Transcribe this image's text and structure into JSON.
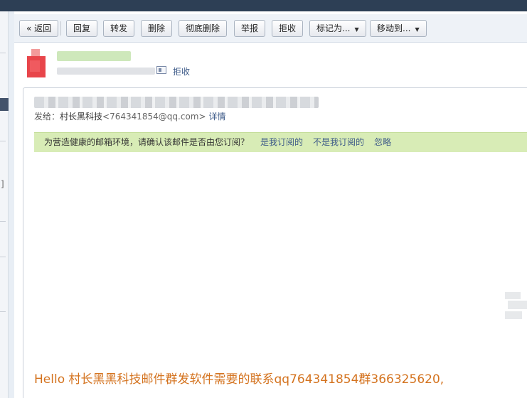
{
  "toolbar": {
    "back": "« 返回",
    "reply": "回复",
    "forward": "转发",
    "delete": "删除",
    "delete_permanent": "彻底删除",
    "report": "举报",
    "reject": "拒收",
    "mark_as": "标记为...",
    "move_to": "移动到..."
  },
  "header": {
    "reject_link": "拒收"
  },
  "mail": {
    "sendto_label": "发给：",
    "recipient_name": "村长黑科技",
    "recipient_email": "<764341854@qq.com>",
    "detail_link": "详情"
  },
  "notice": {
    "text": "为营造健康的邮箱环境，请确认该邮件是否由您订阅？",
    "yes_link": "是我订阅的",
    "no_link": "不是我订阅的",
    "ignore_link": "忽略"
  },
  "body": {
    "text": "Hello 村长黑黑科技邮件群发软件需要的联系qq764341854群366325620,"
  },
  "colors": {
    "topbar": "#2d3f55",
    "notice_bg": "#d8ecb6",
    "link": "#3d5a88",
    "body_text": "#d4731f"
  }
}
